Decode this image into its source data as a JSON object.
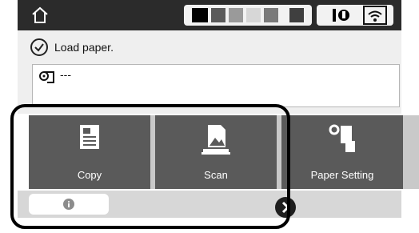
{
  "header": {
    "home_icon": "home-icon",
    "ink_levels": [
      {
        "color": "#000000",
        "level": 1.0
      },
      {
        "color": "#5a5a5a",
        "level": 1.0
      },
      {
        "color": "#9a9a9a",
        "level": 1.0
      },
      {
        "color": "#d7d7d7",
        "level": 1.0
      },
      {
        "color": "#7a7a7a",
        "level": 1.0
      },
      {
        "color": "#3f3f3f",
        "level": 1.0
      }
    ],
    "status_icons": [
      "maintenance-box-icon",
      "wifi-icon"
    ]
  },
  "message": {
    "icon": "check-circle-icon",
    "text": "Load paper."
  },
  "paper_info": {
    "icon": "roll-paper-icon",
    "value": "---"
  },
  "tiles": [
    {
      "label": "Copy",
      "icon": "copy-icon"
    },
    {
      "label": "Scan",
      "icon": "scan-icon"
    },
    {
      "label": "Paper Setting",
      "icon": "paper-setting-icon"
    }
  ],
  "bottom": {
    "info_icon": "info-icon",
    "scroll_icon": "arrow-right-icon"
  }
}
